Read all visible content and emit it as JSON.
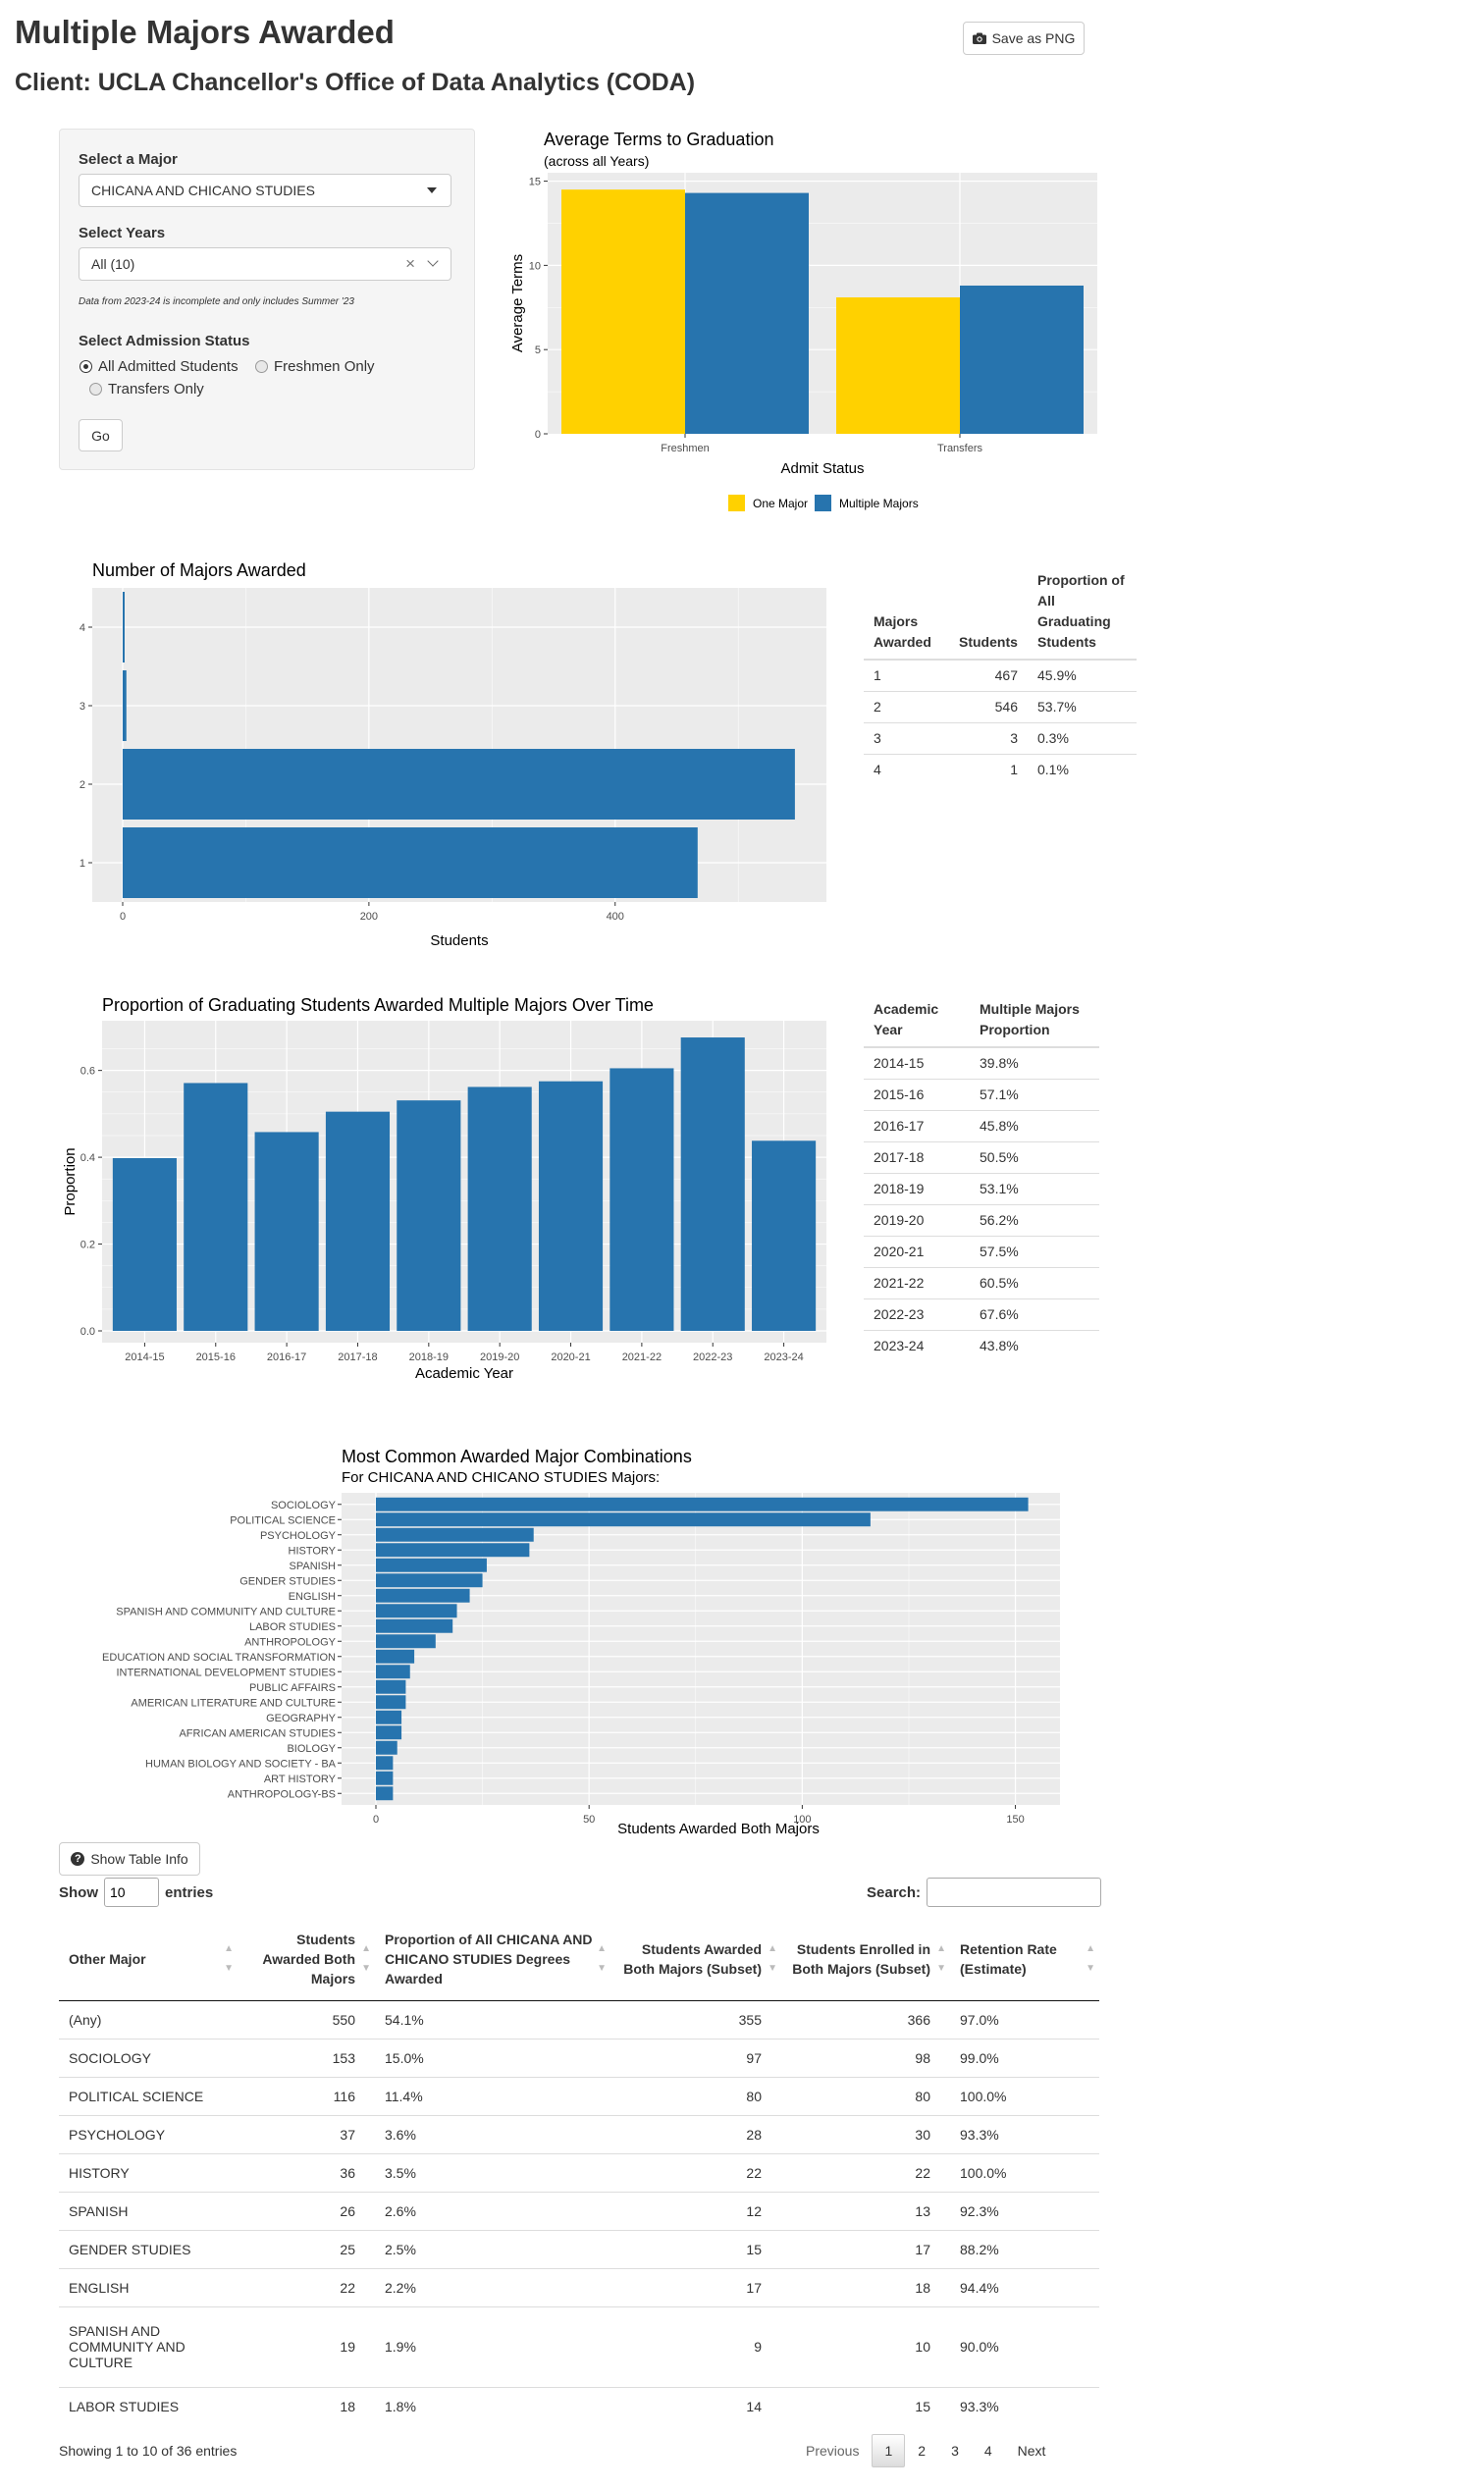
{
  "header": {
    "title": "Multiple Majors Awarded",
    "client": "Client: UCLA Chancellor's Office of Data Analytics (CODA)",
    "save_png_label": "Save as PNG"
  },
  "sidebar": {
    "major_label": "Select a Major",
    "major_value": "CHICANA AND CHICANO STUDIES",
    "years_label": "Select Years",
    "years_value": "All (10)",
    "years_note": "Data from 2023-24 is incomplete and only includes Summer '23",
    "admission_label": "Select Admission Status",
    "admission_options": [
      "All Admitted Students",
      "Freshmen Only",
      "Transfers Only"
    ],
    "admission_selected": "All Admitted Students",
    "go_label": "Go"
  },
  "terms_chart": {
    "title": "Average Terms to Graduation",
    "subtitle": "(across all Years)",
    "xlabel": "Admit Status",
    "ylabel": "Average Terms",
    "legend": [
      "One Major",
      "Multiple Majors"
    ],
    "colors": {
      "one": "#FFD100",
      "multiple": "#2774AE"
    },
    "chart_data": {
      "type": "bar",
      "categories": [
        "Freshmen",
        "Transfers"
      ],
      "series": [
        {
          "name": "One Major",
          "values": [
            14.5,
            8.1
          ]
        },
        {
          "name": "Multiple Majors",
          "values": [
            14.3,
            8.8
          ]
        }
      ],
      "ylim": [
        0,
        15.5
      ],
      "yticks": [
        0,
        5,
        10,
        15
      ]
    }
  },
  "majors_chart": {
    "title": "Number of Majors Awarded",
    "xlabel": "Students",
    "chart_data": {
      "type": "bar",
      "orientation": "horizontal",
      "categories": [
        "1",
        "2",
        "3",
        "4"
      ],
      "values": [
        467,
        546,
        3,
        1
      ],
      "xlim": [
        0,
        570
      ],
      "xticks": [
        0,
        200,
        400
      ]
    }
  },
  "majors_table": {
    "headers": [
      "Majors Awarded",
      "Students",
      "Proportion of All Graduating Students"
    ],
    "rows": [
      [
        "1",
        "467",
        "45.9%"
      ],
      [
        "2",
        "546",
        "53.7%"
      ],
      [
        "3",
        "3",
        "0.3%"
      ],
      [
        "4",
        "1",
        "0.1%"
      ]
    ]
  },
  "proportion_chart": {
    "title": "Proportion of Graduating Students Awarded Multiple Majors Over Time",
    "xlabel": "Academic Year",
    "ylabel": "Proportion",
    "chart_data": {
      "type": "bar",
      "categories": [
        "2014-15",
        "2015-16",
        "2016-17",
        "2017-18",
        "2018-19",
        "2019-20",
        "2020-21",
        "2021-22",
        "2022-23",
        "2023-24"
      ],
      "values": [
        0.398,
        0.571,
        0.458,
        0.505,
        0.531,
        0.562,
        0.575,
        0.605,
        0.676,
        0.438
      ],
      "ylim": [
        0,
        0.71
      ],
      "yticks": [
        "0.0",
        "0.2",
        "0.4",
        "0.6"
      ]
    }
  },
  "proportion_table": {
    "headers": [
      "Academic Year",
      "Multiple Majors Proportion"
    ],
    "rows": [
      [
        "2014-15",
        "39.8%"
      ],
      [
        "2015-16",
        "57.1%"
      ],
      [
        "2016-17",
        "45.8%"
      ],
      [
        "2017-18",
        "50.5%"
      ],
      [
        "2018-19",
        "53.1%"
      ],
      [
        "2019-20",
        "56.2%"
      ],
      [
        "2020-21",
        "57.5%"
      ],
      [
        "2021-22",
        "60.5%"
      ],
      [
        "2022-23",
        "67.6%"
      ],
      [
        "2023-24",
        "43.8%"
      ]
    ]
  },
  "combos_chart": {
    "title": "Most Common Awarded Major Combinations",
    "subtitle": "For CHICANA AND CHICANO STUDIES Majors:",
    "xlabel": "Students Awarded Both Majors",
    "chart_data": {
      "type": "bar",
      "orientation": "horizontal",
      "categories": [
        "SOCIOLOGY",
        "POLITICAL SCIENCE",
        "PSYCHOLOGY",
        "HISTORY",
        "SPANISH",
        "GENDER STUDIES",
        "ENGLISH",
        "SPANISH AND COMMUNITY AND CULTURE",
        "LABOR STUDIES",
        "ANTHROPOLOGY",
        "EDUCATION AND SOCIAL TRANSFORMATION",
        "INTERNATIONAL DEVELOPMENT STUDIES",
        "PUBLIC AFFAIRS",
        "AMERICAN LITERATURE AND CULTURE",
        "GEOGRAPHY",
        "AFRICAN AMERICAN STUDIES",
        "BIOLOGY",
        "HUMAN BIOLOGY AND SOCIETY - BA",
        "ART HISTORY",
        "ANTHROPOLOGY-BS"
      ],
      "values": [
        153,
        116,
        37,
        36,
        26,
        25,
        22,
        19,
        18,
        14,
        9,
        8,
        7,
        7,
        6,
        6,
        5,
        4,
        4,
        4
      ],
      "xlim": [
        0,
        160
      ],
      "xticks": [
        0,
        50,
        100,
        150
      ]
    }
  },
  "table_info_label": "Show Table Info",
  "datatable": {
    "show_label": "Show",
    "entries_label": "entries",
    "length_value": "10",
    "search_label": "Search:",
    "search_value": "",
    "headers": [
      "Other Major",
      "Students Awarded Both Majors",
      "Proportion of All CHICANA AND CHICANO STUDIES Degrees Awarded",
      "Students Awarded Both Majors (Subset)",
      "Students Enrolled in Both Majors (Subset)",
      "Retention Rate (Estimate)"
    ],
    "rows": [
      [
        "(Any)",
        "550",
        "54.1%",
        "355",
        "366",
        "97.0%"
      ],
      [
        "SOCIOLOGY",
        "153",
        "15.0%",
        "97",
        "98",
        "99.0%"
      ],
      [
        "POLITICAL SCIENCE",
        "116",
        "11.4%",
        "80",
        "80",
        "100.0%"
      ],
      [
        "PSYCHOLOGY",
        "37",
        "3.6%",
        "28",
        "30",
        "93.3%"
      ],
      [
        "HISTORY",
        "36",
        "3.5%",
        "22",
        "22",
        "100.0%"
      ],
      [
        "SPANISH",
        "26",
        "2.6%",
        "12",
        "13",
        "92.3%"
      ],
      [
        "GENDER STUDIES",
        "25",
        "2.5%",
        "15",
        "17",
        "88.2%"
      ],
      [
        "ENGLISH",
        "22",
        "2.2%",
        "17",
        "18",
        "94.4%"
      ],
      [
        "SPANISH AND COMMUNITY AND CULTURE",
        "19",
        "1.9%",
        "9",
        "10",
        "90.0%"
      ],
      [
        "LABOR STUDIES",
        "18",
        "1.8%",
        "14",
        "15",
        "93.3%"
      ]
    ],
    "info": "Showing 1 to 10 of 36 entries",
    "pager": [
      "Previous",
      "1",
      "2",
      "3",
      "4",
      "Next"
    ],
    "current_page": "1"
  }
}
